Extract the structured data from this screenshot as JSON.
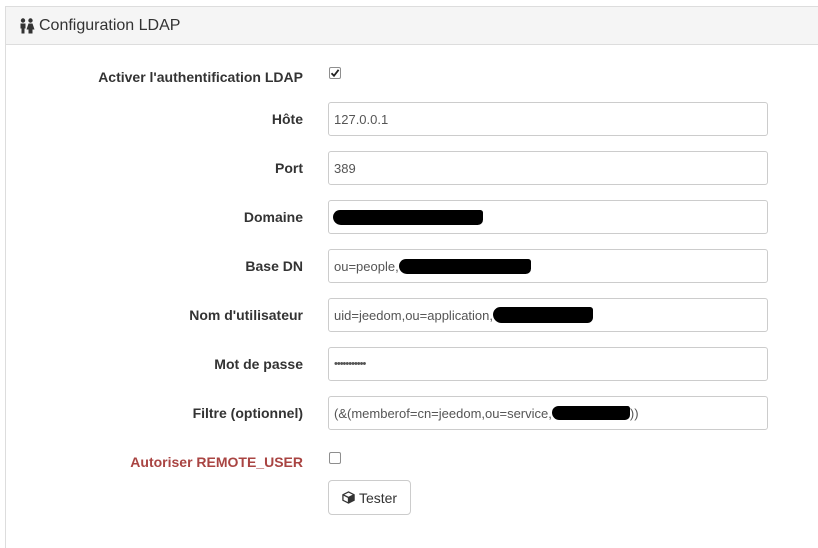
{
  "panel": {
    "title": "Configuration LDAP",
    "title_icon": "users-icon"
  },
  "form": {
    "enable_ldap": {
      "label": "Activer l'authentification LDAP",
      "checked": true
    },
    "host": {
      "label": "Hôte",
      "value": "127.0.0.1"
    },
    "port": {
      "label": "Port",
      "value": "389"
    },
    "domain": {
      "label": "Domaine",
      "value": ""
    },
    "base_dn": {
      "label": "Base DN",
      "value": "ou=people,"
    },
    "username": {
      "label": "Nom d'utilisateur",
      "value": "uid=jeedom,ou=application,"
    },
    "password": {
      "label": "Mot de passe",
      "value": "•••••••••••"
    },
    "filter": {
      "label": "Filtre (optionnel)",
      "value_prefix": "(&(memberof=cn=jeedom,ou=service,",
      "value_suffix": "))"
    },
    "remote_user": {
      "label": "Autoriser REMOTE_USER",
      "checked": false
    }
  },
  "test_button": {
    "label": "Tester",
    "icon": "cube-icon"
  },
  "colors": {
    "warning_label": "#a94442",
    "heading_bg": "#f5f5f5",
    "border": "#cccccc"
  }
}
